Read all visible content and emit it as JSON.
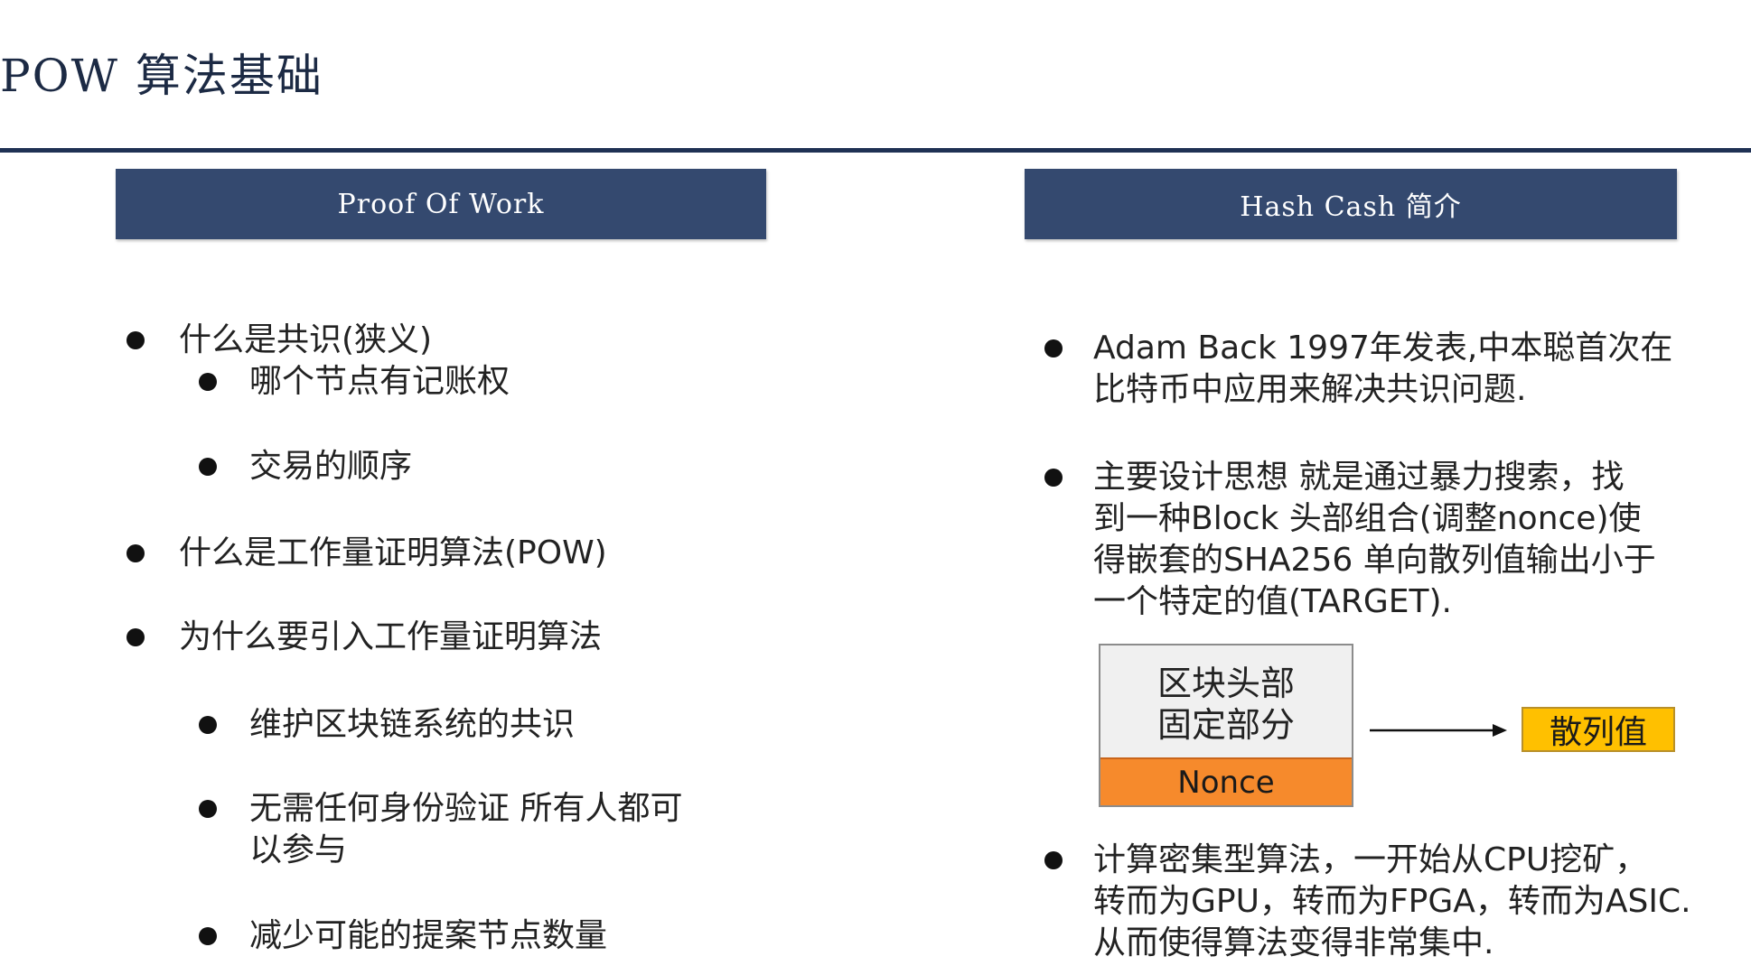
{
  "title": "POW 算法基础",
  "left": {
    "header": "Proof Of Work",
    "items": [
      "什么是共识(狭义)",
      "哪个节点有记账权",
      "交易的顺序",
      "什么是工作量证明算法(POW)",
      "为什么要引入工作量证明算法",
      "维护区块链系统的共识",
      "无需任何身份验证 所有人都可\n以参与",
      "减少可能的提案节点数量"
    ]
  },
  "right": {
    "header": "Hash Cash 简介",
    "items": [
      "Adam Back 1997年发表,中本聪首次在\n比特币中应用来解决共识问题.",
      "主要设计思想 就是通过暴力搜索，找\n到一种Block 头部组合(调整nonce)使\n得嵌套的SHA256 单向散列值输出小于\n一个特定的值(TARGET).",
      "计算密集型算法，一开始从CPU挖矿，\n转而为GPU，转而为FPGA，转而为ASIC.\n从而使得算法变得非常集中."
    ],
    "diagram": {
      "header_label": "区块头部\n固定部分",
      "nonce_label": "Nonce",
      "output_label": "散列值",
      "colors": {
        "nonce": "#f68a2c",
        "output": "#ffc000"
      }
    }
  },
  "colors": {
    "header_bg": "#34496f",
    "rule": "#1f3154"
  }
}
